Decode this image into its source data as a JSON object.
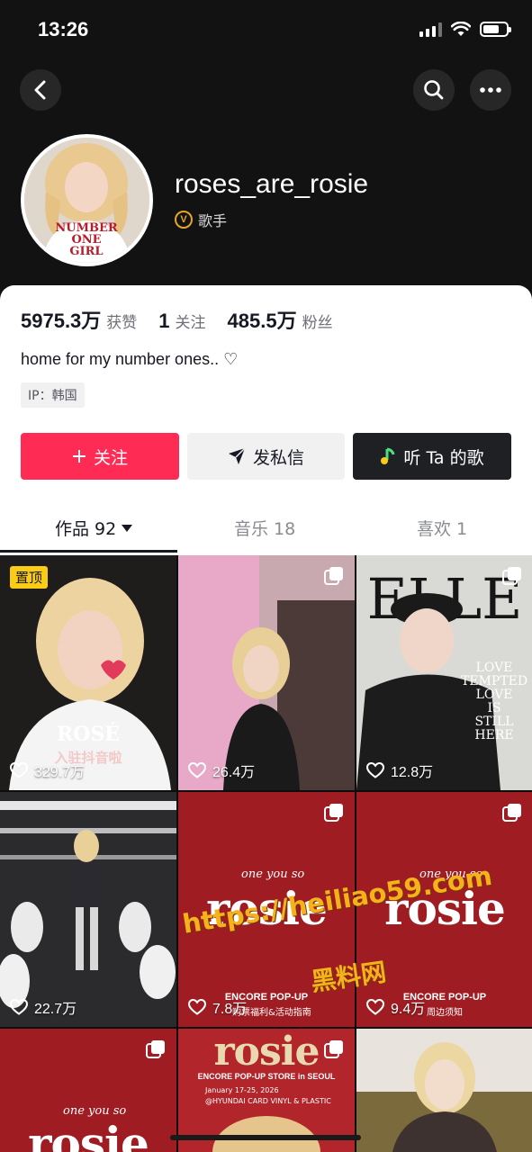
{
  "status_bar": {
    "time": "13:26"
  },
  "header": {
    "username": "roses_are_rosie",
    "verify_badge": "V",
    "verify_label": "歌手"
  },
  "avatar_shirt": [
    "NUMBER",
    "ONE",
    "GIRL"
  ],
  "stats": [
    {
      "value": "5975.3万",
      "label": "获赞"
    },
    {
      "value": "1",
      "label": "关注"
    },
    {
      "value": "485.5万",
      "label": "粉丝"
    }
  ],
  "bio": "home for my number ones.. ♡",
  "ip_tag": "IP：韩国",
  "buttons": {
    "follow": "关注",
    "message": "发私信",
    "listen": "听 Ta 的歌"
  },
  "tabs": [
    {
      "label": "作品 92",
      "active": true
    },
    {
      "label": "音乐 18",
      "active": false
    },
    {
      "label": "喜欢 1",
      "active": false
    }
  ],
  "videos": [
    {
      "likes": "329.7万",
      "pinned_label": "置顶",
      "caption": "ROSÉ",
      "subcaption": "入驻抖音啦",
      "multi": false
    },
    {
      "likes": "26.4万",
      "multi": true
    },
    {
      "likes": "12.8万",
      "multi": true,
      "cover_title": "ELLE",
      "cover_lines": [
        "LOVE",
        "TEMPTED",
        "LOVE",
        "IS",
        "STILL",
        "HERE"
      ]
    },
    {
      "likes": "22.7万",
      "multi": false
    },
    {
      "likes": "7.8万",
      "multi": true,
      "script": "one you so",
      "word": "rosie",
      "popup": "ENCORE POP-UP",
      "note": "购票福利&活动指南"
    },
    {
      "likes": "9.4万",
      "multi": true,
      "script": "one you so",
      "word": "rosie",
      "popup": "ENCORE POP-UP",
      "note": "周边须知"
    },
    {
      "likes": "",
      "multi": true,
      "script": "one you so",
      "word": "rosie"
    },
    {
      "likes": "",
      "multi": true,
      "word": "rosie",
      "popup": "ENCORE POP-UP STORE in SEOUL",
      "note": "January 17-25, 2026",
      "note2": "@HYUNDAI CARD VINYL & PLASTIC"
    },
    {
      "likes": "",
      "multi": false
    }
  ],
  "watermark": {
    "url": "https://heiliao59.com",
    "cn": "黑料网"
  },
  "colors": {
    "accent": "#fe2c55",
    "hero_bg": "#121212",
    "cover_red": "#9f1d22"
  }
}
